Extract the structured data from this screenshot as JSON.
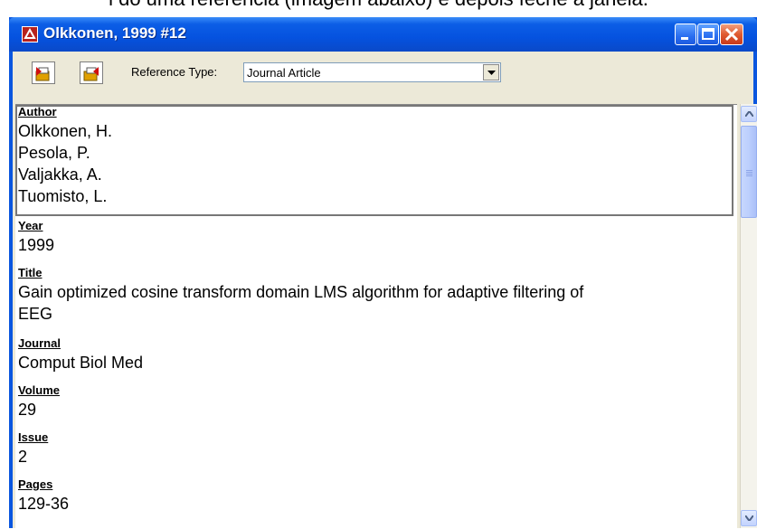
{
  "caption": "i do uma referência (imagem abaixo) e depois feche a janela.",
  "window": {
    "title": "Olkkonen, 1999 #12",
    "icon": "endnote-app-icon",
    "controls": [
      "minimize-button",
      "maximize-button",
      "close-button"
    ]
  },
  "toolbar": {
    "prev_icon": "previous-reference-icon",
    "next_icon": "next-reference-icon",
    "ref_type_label": "Reference Type:",
    "ref_type_value": "Journal Article"
  },
  "fields": [
    {
      "label": "Author",
      "values": [
        "Olkkonen, H.",
        "Pesola, P.",
        "Valjakka, A.",
        "Tuomisto, L."
      ]
    },
    {
      "label": "Year",
      "values": [
        "1999"
      ]
    },
    {
      "label": "Title",
      "values": [
        "Gain optimized cosine transform domain LMS algorithm for adaptive filtering of",
        "EEG"
      ]
    },
    {
      "label": "Journal",
      "values": [
        "Comput Biol Med"
      ]
    },
    {
      "label": "Volume",
      "values": [
        "29"
      ]
    },
    {
      "label": "Issue",
      "values": [
        "2"
      ]
    },
    {
      "label": "Pages",
      "values": [
        "129-36"
      ]
    }
  ],
  "colors": {
    "titlebar": "#0a56df",
    "window_face": "#ece9d8",
    "close_button": "#e05a30"
  }
}
